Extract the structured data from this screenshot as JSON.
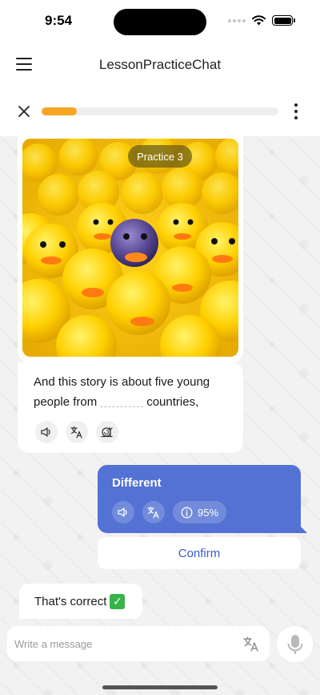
{
  "status": {
    "time": "9:54"
  },
  "header": {
    "title": "LessonPracticeChat"
  },
  "progress": {
    "value": 0.15,
    "color": "#f5a623"
  },
  "lesson": {
    "badge": "Practice 3",
    "question_part1": "And this story is about five young people from",
    "question_part2": "countries,"
  },
  "answer": {
    "text": "Different",
    "score": "95%",
    "bubble_color": "#5472d3"
  },
  "confirm": {
    "label": "Confirm"
  },
  "feedback": {
    "text": "That's correct",
    "emoji": "✓"
  },
  "composer": {
    "placeholder": "Write a message"
  },
  "icons": {
    "menu": "menu-icon",
    "close": "close-icon",
    "more": "more-vertical-icon",
    "speaker": "speaker-icon",
    "translate": "translate-icon",
    "slow": "snail-icon",
    "info": "info-icon",
    "mic": "microphone-icon"
  }
}
